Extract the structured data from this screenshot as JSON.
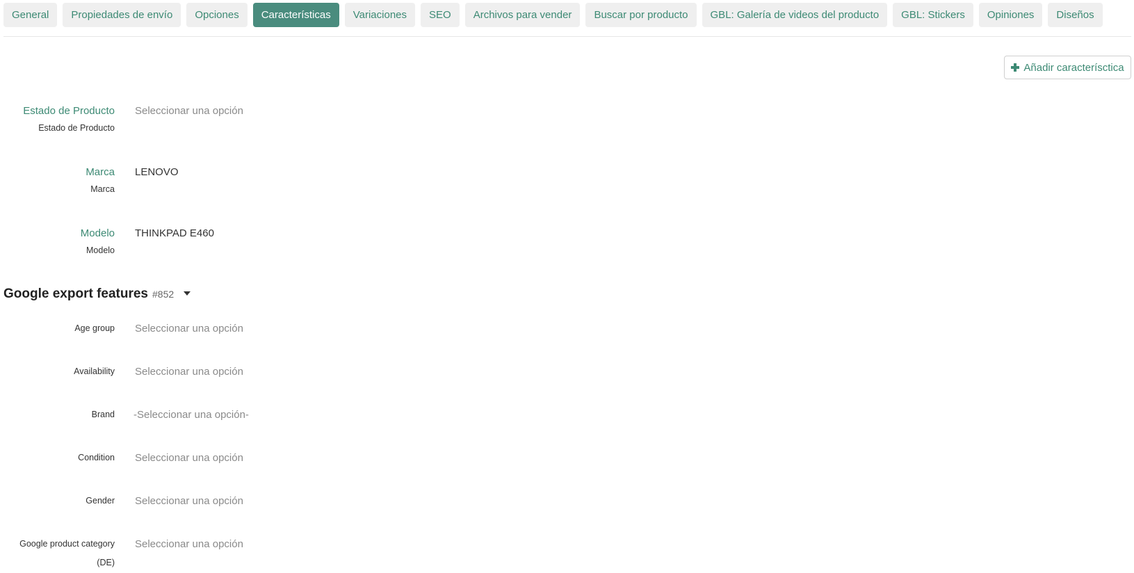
{
  "tabs": [
    {
      "label": "General",
      "active": false
    },
    {
      "label": "Propiedades de envío",
      "active": false
    },
    {
      "label": "Opciones",
      "active": false
    },
    {
      "label": "Características",
      "active": true
    },
    {
      "label": "Variaciones",
      "active": false
    },
    {
      "label": "SEO",
      "active": false
    },
    {
      "label": "Archivos para vender",
      "active": false
    },
    {
      "label": "Buscar por producto",
      "active": false
    },
    {
      "label": "GBL: Galería de videos del producto",
      "active": false
    },
    {
      "label": "GBL: Stickers",
      "active": false
    },
    {
      "label": "Opiniones",
      "active": false
    },
    {
      "label": "Diseños",
      "active": false
    }
  ],
  "add_feature_label": "Añadir caracterísctica",
  "features": [
    {
      "label": "Estado de Producto",
      "sublabel": "Estado de Producto",
      "value": "Seleccionar una opción"
    },
    {
      "label": "Marca",
      "sublabel": "Marca",
      "value": "LENOVO"
    },
    {
      "label": "Modelo",
      "sublabel": "Modelo",
      "value": "THINKPAD E460"
    }
  ],
  "group": {
    "title": "Google export features",
    "id": "#852",
    "fields": [
      {
        "label": "Age group",
        "value": "Seleccionar una opción"
      },
      {
        "label": "Availability",
        "value": "Seleccionar una opción"
      },
      {
        "label": "Brand",
        "value": "-Seleccionar una opción-"
      },
      {
        "label": "Condition",
        "value": "Seleccionar una opción"
      },
      {
        "label": "Gender",
        "value": "Seleccionar una opción"
      },
      {
        "label": "Google product category (DE)",
        "value": "Seleccionar una opción"
      }
    ]
  },
  "colors": {
    "accent": "#4a8c7e",
    "link": "#3d8a74",
    "placeholder": "#8a8a8a"
  }
}
